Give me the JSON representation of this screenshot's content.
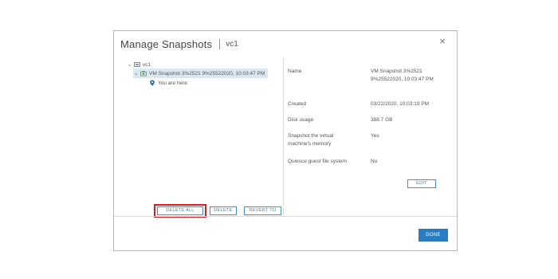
{
  "dialog": {
    "title": "Manage Snapshots",
    "subtitle": "vc1",
    "close_glyph": "×"
  },
  "tree": {
    "root": {
      "label": "vc1",
      "icon": "vm-icon",
      "expanded": true
    },
    "snapshot": {
      "label": "VM Snapshot 3%2521 9%25522020, 10:03:47 PM",
      "icon": "snapshot-icon",
      "selected": true
    },
    "current": {
      "label": "You are here",
      "icon": "location-pin-icon"
    }
  },
  "details": [
    {
      "label": "Name",
      "value": "VM Snapshot 3%2521 9%25522020, 10:03:47 PM"
    },
    {
      "label": "Created",
      "value": "03/22/2020, 10:03:19 PM"
    },
    {
      "label": "Disk usage",
      "value": "388.7 GB"
    },
    {
      "label": "Snapshot the virtual machine's memory",
      "value": "Yes"
    },
    {
      "label": "Quiesce guest file system",
      "value": "No"
    }
  ],
  "buttons": {
    "edit": "EDIT",
    "delete_all": "DELETE ALL",
    "delete": "DELETE",
    "revert_to": "REVERT TO",
    "done": "DONE"
  },
  "colors": {
    "accent": "#2a7cbf",
    "highlight": "#d0202a",
    "selected_bg": "#d9e7f2"
  }
}
